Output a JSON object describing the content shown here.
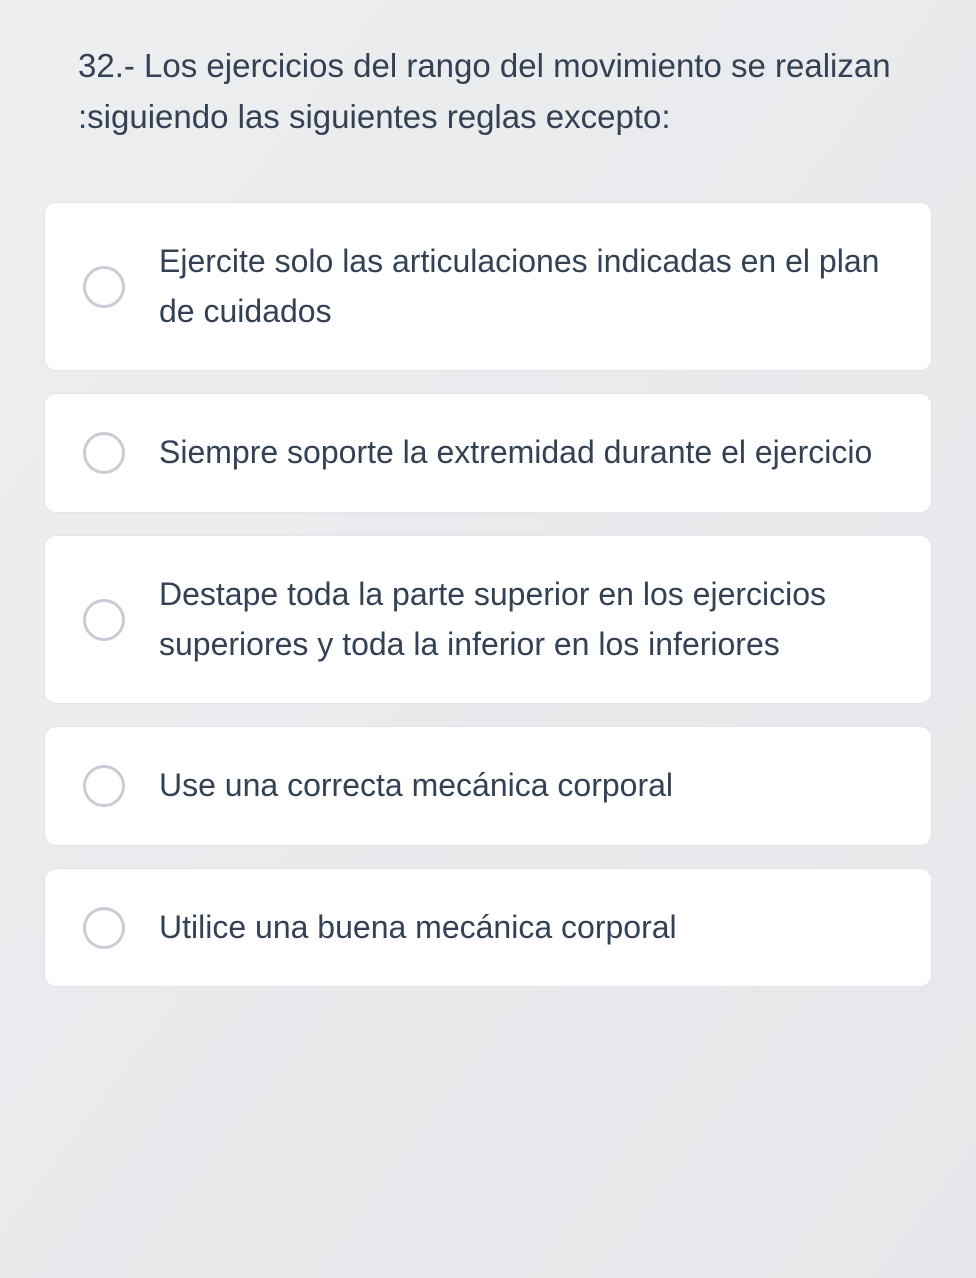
{
  "question": {
    "number": "32.-",
    "text": "32.- Los ejercicios del rango del movimiento se realizan :siguiendo las siguientes reglas excepto:"
  },
  "options": [
    {
      "label": "Ejercite solo las articulaciones indicadas en el plan de cuidados"
    },
    {
      "label": "Siempre soporte la extremidad durante el ejercicio"
    },
    {
      "label": "Destape toda la parte superior en los ejercicios superiores y toda la inferior en los inferiores"
    },
    {
      "label": "Use una correcta mecánica corporal"
    },
    {
      "label": "Utilice una buena mecánica corporal"
    }
  ]
}
